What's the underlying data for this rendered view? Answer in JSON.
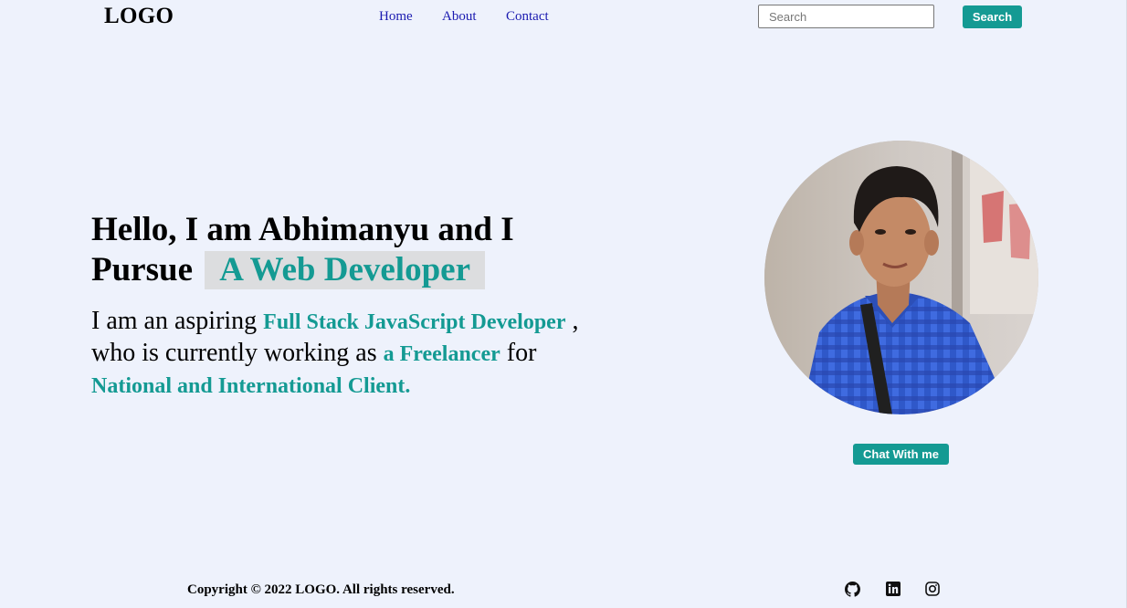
{
  "header": {
    "logo": "LOGO",
    "nav": [
      {
        "label": "Home"
      },
      {
        "label": "About"
      },
      {
        "label": "Contact"
      }
    ],
    "search": {
      "placeholder": "Search",
      "value": "",
      "button_label": "Search"
    }
  },
  "hero": {
    "title_line": "Hello, I am Abhimanyu and I Pursue",
    "title_highlight": "A Web Developer",
    "text_1": "I am an aspiring ",
    "accent_1": "Full Stack JavaScript Developer",
    "text_2": " , who is currently working as ",
    "accent_2": "a Freelancer",
    "text_3": " for ",
    "accent_3": "National and International Client."
  },
  "profile": {
    "chat_button_label": "Chat With me"
  },
  "footer": {
    "copyright": "Copyright © 2022 LOGO. All rights reserved.",
    "social_icons": [
      "github-icon",
      "linkedin-icon",
      "instagram-icon"
    ]
  },
  "colors": {
    "background": "#eef2fc",
    "accent": "#149a93",
    "nav_link": "#1a1ab0",
    "highlight_bg": "#dcdddf"
  }
}
